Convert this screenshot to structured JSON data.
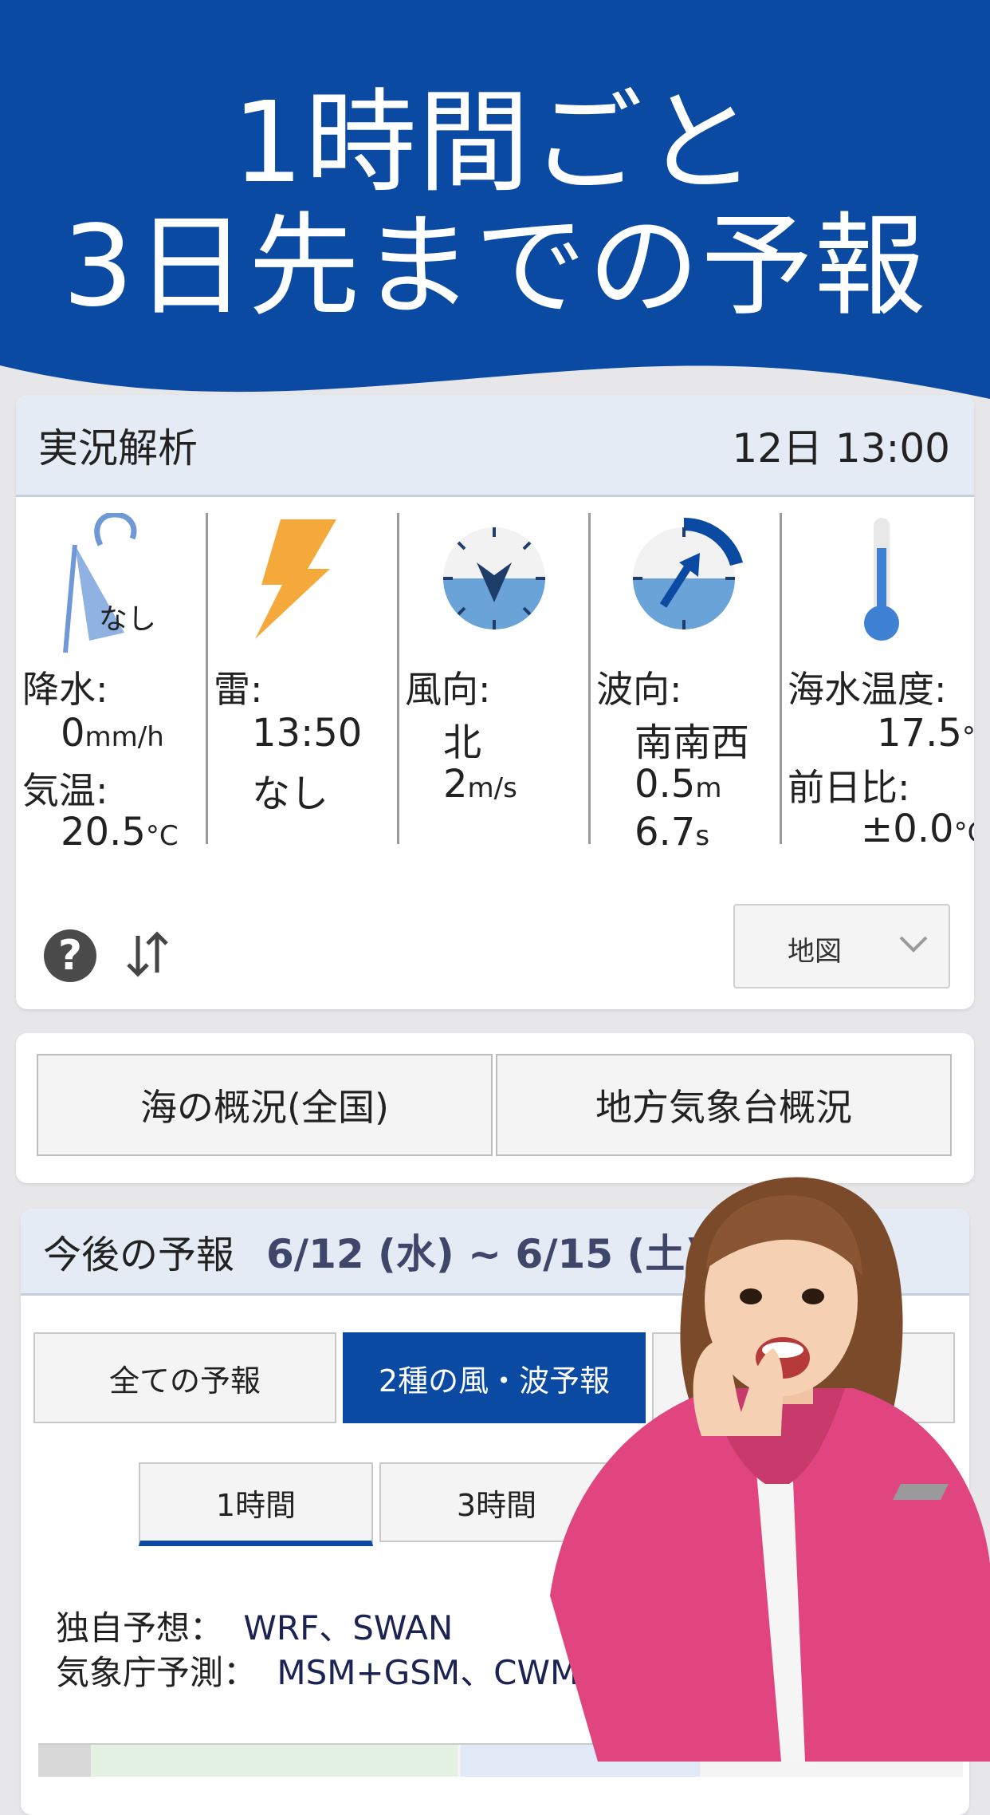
{
  "banner": {
    "line1": "1時間ごと",
    "line2": "3日先までの予報",
    "color": "#0b4aa2"
  },
  "current": {
    "title": "実況解析",
    "datetime": "12日 13:00",
    "rain": {
      "icon": "umbrella-icon",
      "badge": "なし",
      "label": "降水:",
      "value": "0",
      "unit": "mm/h",
      "temp_label": "気温:",
      "temp_value": "20.5",
      "temp_unit": "°C"
    },
    "thunder": {
      "icon": "lightning-icon",
      "label": "雷:",
      "time": "13:50",
      "status": "なし"
    },
    "wind": {
      "icon": "wind-compass-icon",
      "label": "風向:",
      "direction": "北",
      "speed": "2",
      "unit": "m/s"
    },
    "wave": {
      "icon": "wave-compass-icon",
      "label": "波向:",
      "direction": "南南西",
      "height": "0.5",
      "height_unit": "m",
      "period": "6.7",
      "period_unit": "s"
    },
    "sea_temp": {
      "icon": "thermometer-icon",
      "label": "海水温度:",
      "value": "17.5",
      "unit": "°C",
      "diff_label": "前日比:",
      "diff_value": "±0.0",
      "diff_unit": "°C"
    },
    "map_select": "地図"
  },
  "overview": {
    "national": "海の概況(全国)",
    "local": "地方気象台概況"
  },
  "forecast": {
    "title": "今後の予報",
    "range": "6/12 (水) ~ 6/15 (土)",
    "tabs": [
      "全ての予報",
      "2種の風・波予報"
    ],
    "active_tab": 1,
    "subtabs": [
      "1時間",
      "3時間"
    ],
    "active_subtab": 0,
    "own_label": "独自予想：",
    "own_models": "WRF、SWAN",
    "jma_label": "気象庁予測：",
    "jma_models": "MSM+GSM、CWM"
  }
}
